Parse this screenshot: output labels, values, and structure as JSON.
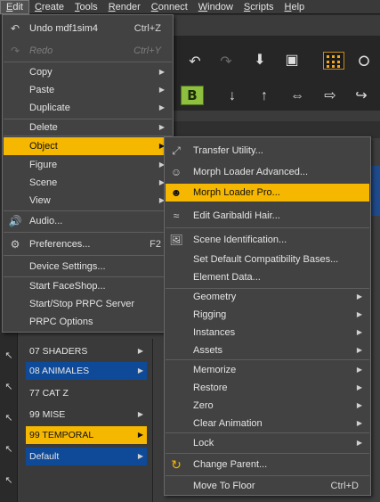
{
  "menubar": {
    "items": [
      {
        "label": "Edit",
        "mnemonic": "E",
        "rest": "dit"
      },
      {
        "label": "Create",
        "mnemonic": "C",
        "rest": "reate"
      },
      {
        "label": "Tools",
        "mnemonic": "T",
        "rest": "ools"
      },
      {
        "label": "Render",
        "mnemonic": "R",
        "rest": "ender"
      },
      {
        "label": "Connect",
        "mnemonic": "C",
        "rest": "onnect"
      },
      {
        "label": "Window",
        "mnemonic": "W",
        "rest": "indow"
      },
      {
        "label": "Scripts",
        "mnemonic": "S",
        "rest": "cripts"
      },
      {
        "label": "Help",
        "mnemonic": "H",
        "rest": "elp"
      }
    ]
  },
  "edit_menu": {
    "undo": {
      "label": "Undo mdf1sim4",
      "shortcut": "Ctrl+Z"
    },
    "redo": {
      "label": "Redo",
      "shortcut": "Ctrl+Y"
    },
    "copy": "Copy",
    "paste": "Paste",
    "duplicate": "Duplicate",
    "delete": "Delete",
    "object": "Object",
    "figure": "Figure",
    "scene": "Scene",
    "view": "View",
    "audio": "Audio...",
    "preferences": {
      "label": "Preferences...",
      "shortcut": "F2"
    },
    "device_settings": "Device Settings...",
    "start_faceshop": "Start FaceShop...",
    "start_stop_prpc": "Start/Stop PRPC Server",
    "prpc_options": "PRPC Options"
  },
  "object_submenu": {
    "transfer_utility": "Transfer Utility...",
    "morph_loader_advanced": "Morph Loader Advanced...",
    "morph_loader_pro": "Morph Loader Pro...",
    "edit_garibaldi_hair": "Edit Garibaldi Hair...",
    "scene_identification": "Scene Identification...",
    "set_default_compat": "Set Default Compatibility Bases...",
    "element_data": "Element Data...",
    "geometry": "Geometry",
    "rigging": "Rigging",
    "instances": "Instances",
    "assets": "Assets",
    "memorize": "Memorize",
    "restore": "Restore",
    "zero": "Zero",
    "clear_animation": "Clear Animation",
    "lock": "Lock",
    "change_parent": "Change Parent...",
    "move_to_floor": {
      "label": "Move To Floor",
      "shortcut": "Ctrl+D"
    }
  },
  "category_list": [
    {
      "label": "07 SHADERS",
      "style": "plain"
    },
    {
      "label": "08 ANIMALES",
      "style": "blue"
    },
    {
      "label": "77 CAT Z",
      "style": "plain"
    },
    {
      "label": "99 MISE",
      "style": "plain"
    },
    {
      "label": "99 TEMPORAL",
      "style": "orange"
    },
    {
      "label": "Default",
      "style": "blue"
    }
  ],
  "toolbar": {
    "b_button": "B"
  },
  "colors": {
    "highlight": "#f5b700",
    "selection_blue": "#0f4a98",
    "menu_bg": "#424242"
  }
}
